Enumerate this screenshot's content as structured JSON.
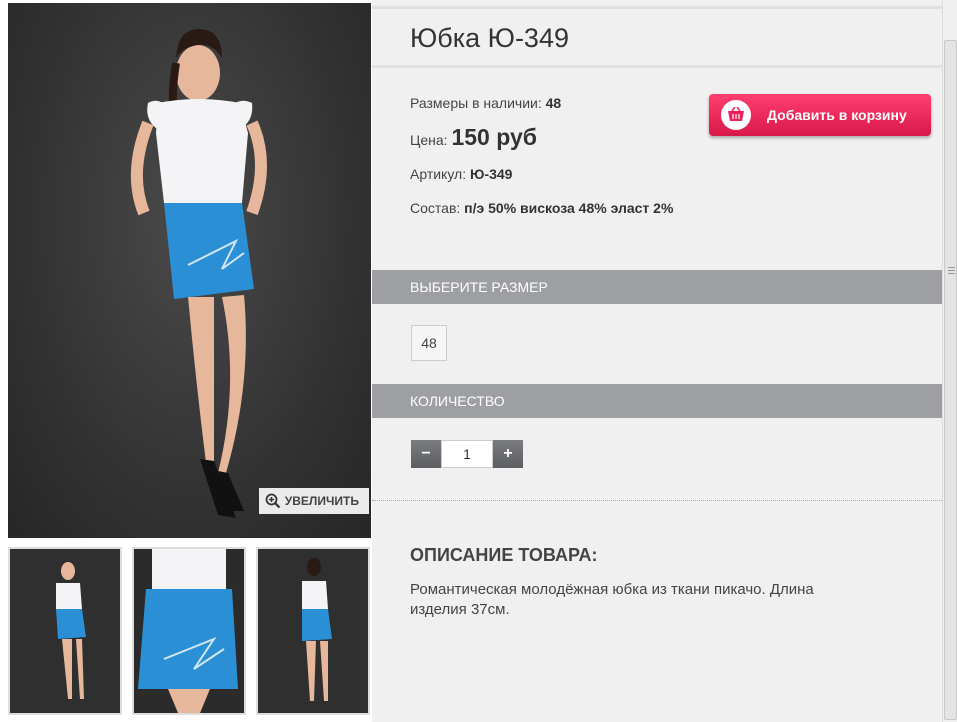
{
  "product": {
    "title": "Юбка Ю-349",
    "sizes_label": "Размеры в наличии:",
    "sizes_value": "48",
    "price_label": "Цена:",
    "price_value": "150 руб",
    "article_label": "Артикул:",
    "article_value": "Ю-349",
    "composition_label": "Состав:",
    "composition_value": "п/э 50% вискоза 48% эласт 2%"
  },
  "cart_button": {
    "label": "Добавить в корзину",
    "icon": "basket-icon"
  },
  "gallery": {
    "zoom_label": "УВЕЛИЧИТЬ",
    "zoom_icon": "magnifier-plus-icon",
    "thumbnails": 3
  },
  "size_section": {
    "heading": "ВЫБЕРИТЕ РАЗМЕР",
    "options": [
      "48"
    ]
  },
  "quantity_section": {
    "heading": "КОЛИЧЕСТВО",
    "value": "1",
    "minus": "−",
    "plus": "+"
  },
  "description": {
    "heading": "ОПИСАНИЕ ТОВАРА:",
    "text": "Романтическая молодёжная юбка из ткани пикачо. Длина изделия 37см."
  },
  "colors": {
    "accent": "#e8215a",
    "section_bg": "#9d9fa3",
    "skirt": "#2b8fd6"
  }
}
